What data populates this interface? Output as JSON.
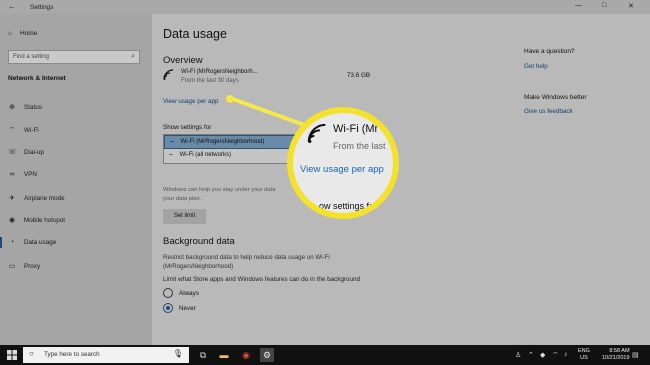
{
  "window": {
    "title": "Settings",
    "back_glyph": "←",
    "minimize_glyph": "—",
    "maximize_glyph": "□",
    "close_glyph": "✕"
  },
  "sidebar": {
    "home_label": "Home",
    "search_placeholder": "Find a setting",
    "section_title": "Network & Internet",
    "items": [
      {
        "label": "Status",
        "icon": "globe-icon"
      },
      {
        "label": "Wi-Fi",
        "icon": "wifi-icon"
      },
      {
        "label": "Dial-up",
        "icon": "phone-icon"
      },
      {
        "label": "VPN",
        "icon": "vpn-icon"
      },
      {
        "label": "Airplane mode",
        "icon": "airplane-icon"
      },
      {
        "label": "Mobile hotspot",
        "icon": "hotspot-icon"
      },
      {
        "label": "Data usage",
        "icon": "data-usage-icon",
        "active": true
      },
      {
        "label": "Proxy",
        "icon": "proxy-icon"
      }
    ]
  },
  "main": {
    "title": "Data usage",
    "overview_title": "Overview",
    "network_name": "Wi-Fi (MrRogersNeighborh...",
    "network_sub": "From the last 30 days",
    "usage_amount": "73.6 GB",
    "view_usage_link": "View usage per app",
    "show_settings_label": "Show settings for",
    "networks": [
      {
        "label": "Wi-Fi (MrRogersNeighborhood)",
        "selected": true
      },
      {
        "label": "Wi-Fi (all networks)",
        "selected": false
      }
    ],
    "desc_line1": "Windows can help you stay under your data",
    "desc_line2": "your data plan.",
    "set_limit_label": "Set limit",
    "background_title": "Background data",
    "background_desc1": "Restrict background data to help reduce data usage on Wi-Fi",
    "background_desc2": "(MrRogersNeighborhood)",
    "limit_label": "Limit what Store apps and Windows features can do in the background",
    "radio_always": "Always",
    "radio_never": "Never",
    "radio_selected": "Never"
  },
  "right_panel": {
    "question_title": "Have a question?",
    "get_help": "Get help",
    "better_title": "Make Windows better",
    "feedback": "Give us feedback"
  },
  "magnifier": {
    "name": "Wi-Fi (Mr",
    "sub": "From the last",
    "link": "View usage per app",
    "label": "ow settings fo"
  },
  "taskbar": {
    "search_text": "Type here to search",
    "lang_line1": "ENG",
    "lang_line2": "US",
    "time": "8:58 AM",
    "date": "10/21/2019"
  },
  "colors": {
    "accent": "#12406a",
    "highlight": "#f3e12c",
    "link_magnified": "#1a64b6"
  }
}
